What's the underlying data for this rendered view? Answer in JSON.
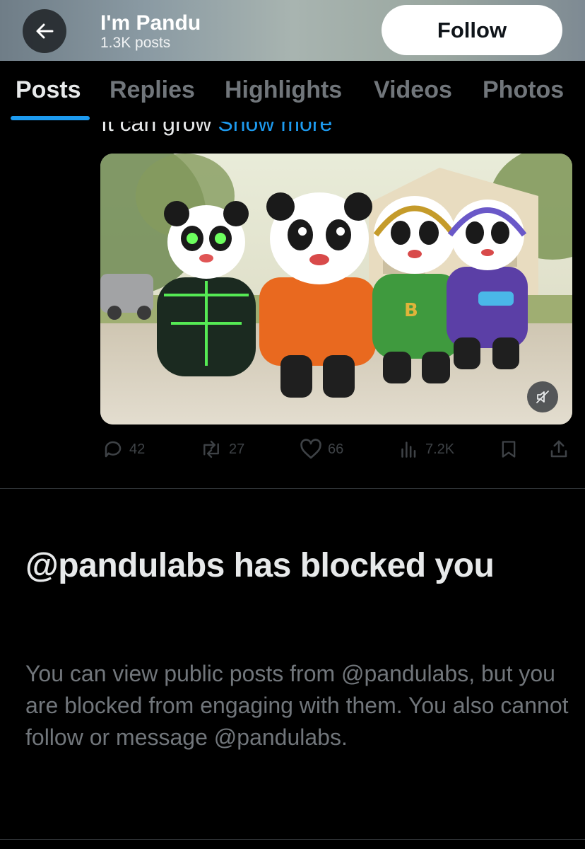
{
  "header": {
    "title": "I'm Pandu",
    "post_count": "1.3K posts",
    "follow_label": "Follow"
  },
  "tabs": [
    {
      "label": "Posts",
      "active": true
    },
    {
      "label": "Replies",
      "active": false
    },
    {
      "label": "Highlights",
      "active": false
    },
    {
      "label": "Videos",
      "active": false
    },
    {
      "label": "Photos",
      "active": false
    }
  ],
  "post": {
    "text_tail": "It can grow",
    "show_more": "Show more",
    "media_description_icon": "video-thumbnail",
    "stats": {
      "replies": "42",
      "reposts": "27",
      "likes": "66",
      "views": "7.2K"
    }
  },
  "blocked": {
    "title": "@pandulabs has blocked you",
    "body": "You can view public posts from @pandulabs, but you are blocked from engaging with them. You also cannot follow or message @pandulabs."
  },
  "colors": {
    "accent": "#1d9bf0",
    "background": "#000000",
    "muted_text": "#71767b",
    "primary_text": "#e7e9ea"
  }
}
